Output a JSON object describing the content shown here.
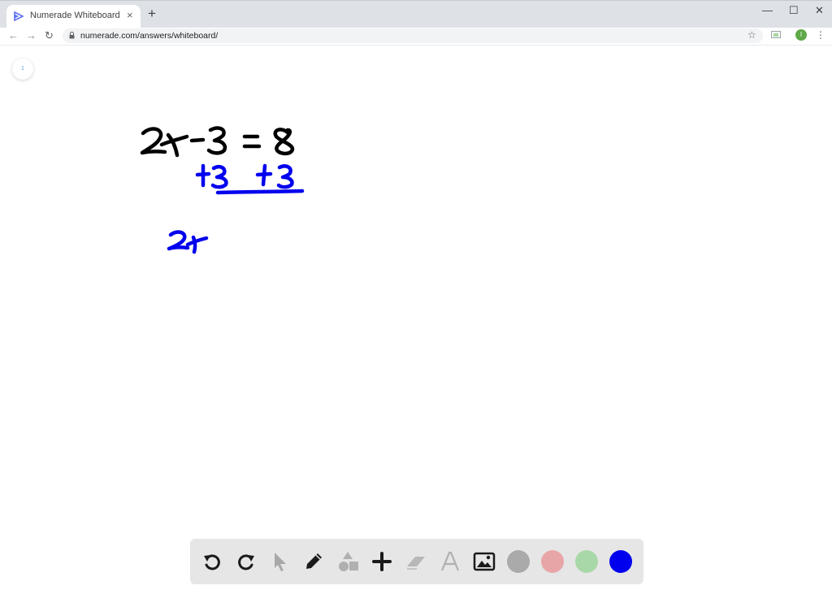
{
  "browser": {
    "tab_title": "Numerade Whiteboard",
    "tab_close": "×",
    "new_tab": "+",
    "url": "numerade.com/answers/whiteboard/",
    "profile_initial": "I",
    "window_controls": {
      "minimize": "—",
      "maximize": "☐",
      "close": "✕"
    },
    "nav": {
      "back": "←",
      "forward": "→",
      "reload": "↻"
    },
    "star": "☆",
    "menu": "⋮"
  },
  "whiteboard": {
    "page_number": "1",
    "handwriting": {
      "line1": "2x - 3 = 8",
      "line2": "+3  +3",
      "line3": "2x"
    },
    "ink_colors": {
      "black": "#000000",
      "blue": "#0000ee"
    }
  },
  "toolbar": {
    "tools": [
      "undo-icon",
      "redo-icon",
      "pointer-icon",
      "pencil-icon",
      "shapes-icon",
      "add-icon",
      "eraser-icon",
      "text-icon",
      "image-icon"
    ],
    "colors": [
      "#aaaaaa",
      "#e8a5a8",
      "#a8d8a8",
      "#0000ee"
    ],
    "selected_color": "#0000ee"
  }
}
